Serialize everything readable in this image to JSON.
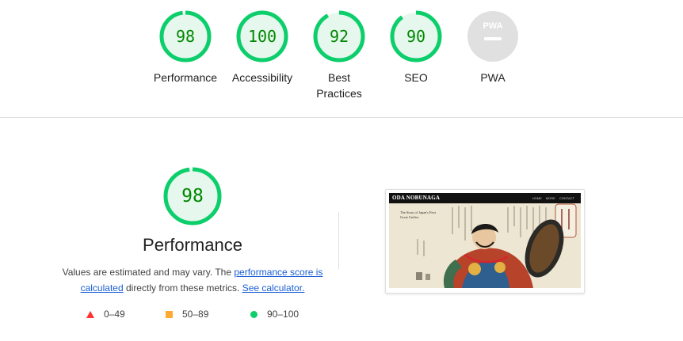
{
  "summary_gauges": [
    {
      "score": "98",
      "label": "Performance"
    },
    {
      "score": "100",
      "label": "Accessibility"
    },
    {
      "score": "92",
      "label": "Best Practices"
    },
    {
      "score": "90",
      "label": "SEO"
    },
    {
      "score": "",
      "label": "PWA"
    }
  ],
  "pwa_badge": {
    "text": "PWA"
  },
  "performance": {
    "score": "98",
    "title": "Performance",
    "desc_prefix": "Values are estimated and may vary. The ",
    "link_score": "performance score is calculated",
    "desc_middle": " directly from these metrics. ",
    "link_calc": "See calculator."
  },
  "legend": [
    {
      "range": "0–49",
      "shape": "triangle",
      "color": "#ff3333"
    },
    {
      "range": "50–89",
      "shape": "square",
      "color": "#ffaa33"
    },
    {
      "range": "90–100",
      "shape": "circle",
      "color": "#0cce6b"
    }
  ],
  "screenshot": {
    "brand": "ODA NOBUNAGA",
    "nav": "HOME   MORE   CONTACT",
    "tagline": "The Story of Japan's First Great Unifier"
  },
  "colors": {
    "pass": "#0cce6b",
    "pass_fill": "#e6f7ee",
    "pass_text": "#008800",
    "pwa_grey": "#e0e0e0"
  }
}
